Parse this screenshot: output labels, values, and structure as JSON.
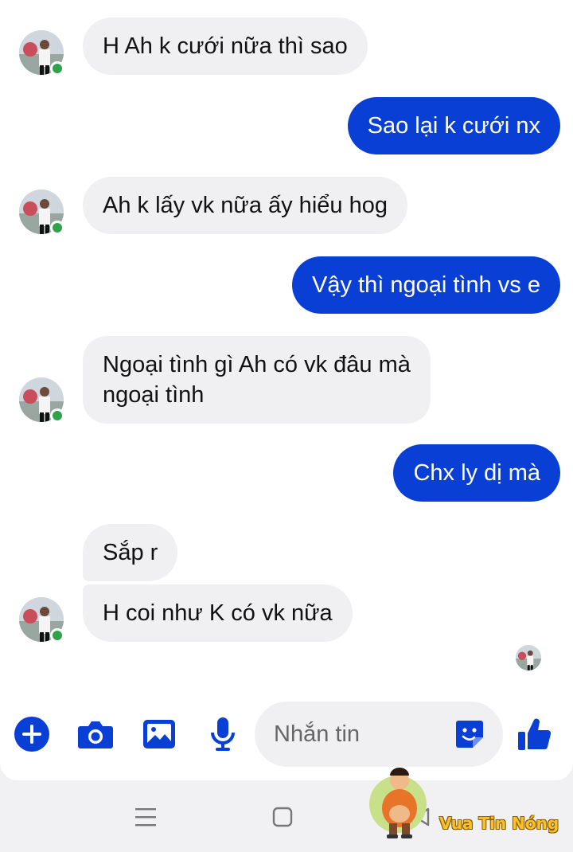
{
  "theme": {
    "outgoing_color": "#0a3fd6",
    "incoming_color": "#f0f0f2",
    "accent": "#0a3fd6",
    "online_color": "#31a24c"
  },
  "messages": [
    {
      "from": "contact",
      "text": "H Ah k cưới nữa thì sao"
    },
    {
      "from": "me",
      "text": "Sao lại k cưới nx"
    },
    {
      "from": "contact",
      "text": "Ah k lấy vk nữa ấy hiểu hog"
    },
    {
      "from": "me",
      "text": "Vậy thì ngoại tình vs e"
    },
    {
      "from": "contact",
      "text_line1": "Ngoại tình gì Ah có vk đâu mà",
      "text_line2": "ngoại tình"
    },
    {
      "from": "me",
      "text": "Chx ly dị mà"
    },
    {
      "from": "contact",
      "text": "Sắp r"
    },
    {
      "from": "contact",
      "text": "H coi như K có vk nữa"
    }
  ],
  "composer": {
    "placeholder": "Nhắn tin",
    "icons": [
      "plus-icon",
      "camera-icon",
      "image-icon",
      "microphone-icon",
      "sticker-icon",
      "thumbs-up-icon"
    ]
  },
  "navigation": {
    "icons": [
      "recent-apps-icon",
      "home-icon",
      "back-icon"
    ]
  },
  "watermark": {
    "text": "Vua Tin Nóng"
  }
}
